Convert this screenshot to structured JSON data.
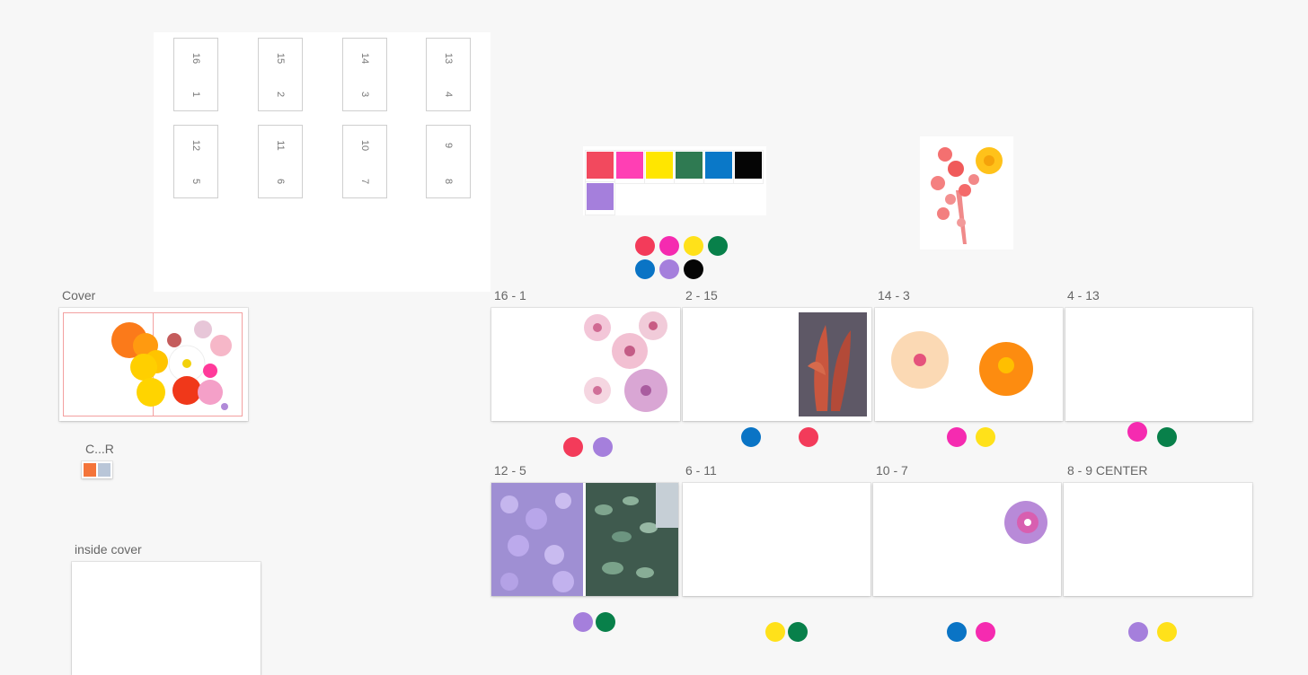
{
  "imposition": {
    "slots": [
      {
        "top": "16",
        "bottom": "1"
      },
      {
        "top": "15",
        "bottom": "2"
      },
      {
        "top": "14",
        "bottom": "3"
      },
      {
        "top": "13",
        "bottom": "4"
      },
      {
        "top": "12",
        "bottom": "5"
      },
      {
        "top": "11",
        "bottom": "6"
      },
      {
        "top": "10",
        "bottom": "7"
      },
      {
        "top": "9",
        "bottom": "8"
      }
    ]
  },
  "swatch_card": {
    "colors": [
      {
        "hex": "#f2495e"
      },
      {
        "hex": "#ff3fb4"
      },
      {
        "hex": "#ffe600"
      },
      {
        "hex": "#2f7a52"
      },
      {
        "hex": "#0a78c8"
      },
      {
        "hex": "#050505"
      },
      {
        "hex": "#a57fdc"
      }
    ]
  },
  "palette_dots": [
    "#f33b5a",
    "#f52bb0",
    "#ffe11a",
    "#08804a",
    "#0a74c5",
    "#a57fdc",
    "#050505"
  ],
  "frames": {
    "cover": {
      "label": "Cover"
    },
    "cr": {
      "label": "C...R"
    },
    "inside_cover": {
      "label": "inside cover"
    },
    "p16_1": {
      "label": "16 - 1",
      "dots": [
        "#f33b5a",
        "#a57fdc"
      ]
    },
    "p2_15": {
      "label": "2 - 15",
      "dots": [
        "#0a74c5",
        "#f33b5a"
      ]
    },
    "p14_3": {
      "label": "14 - 3",
      "dots": [
        "#f52bb0",
        "#ffe11a"
      ]
    },
    "p4_13": {
      "label": "4 - 13",
      "dots": [
        "#f52bb0",
        "#08804a"
      ]
    },
    "p12_5": {
      "label": "12 - 5",
      "dots": [
        "#a57fdc",
        "#08804a"
      ]
    },
    "p6_11": {
      "label": "6 - 11",
      "dots": [
        "#ffe11a",
        "#08804a"
      ]
    },
    "p10_7": {
      "label": "10 - 7",
      "dots": [
        "#0a74c5",
        "#f52bb0"
      ]
    },
    "p8_9": {
      "label": "8 - 9 CENTER",
      "dots": [
        "#a57fdc",
        "#ffe11a"
      ]
    }
  }
}
